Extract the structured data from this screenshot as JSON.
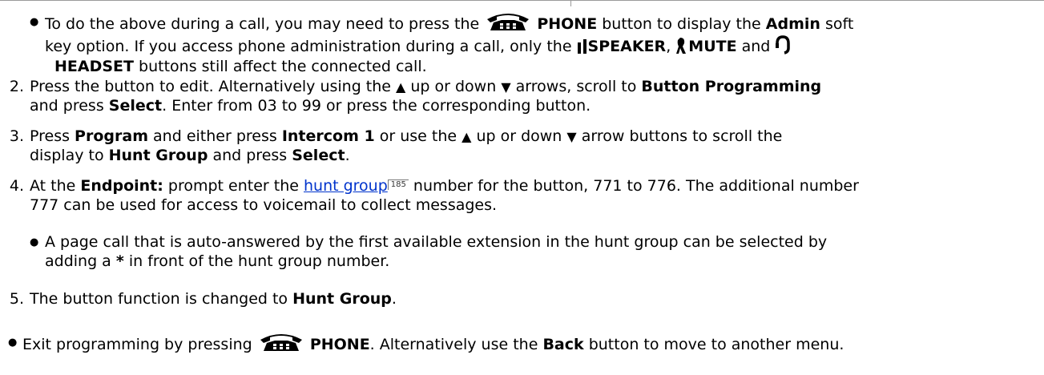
{
  "sub_bullet_1": {
    "part1": "To do the above during a call, you may need to press the ",
    "phone_label": "PHONE",
    "part2": " button to display the ",
    "admin_label": "Admin",
    "part3": " soft",
    "line2_part1": "key option. If you access phone administration during a call, only the ",
    "speaker_label": "SPEAKER",
    "comma": ",",
    "mute_label": "MUTE",
    "and": " and",
    "headset_label": "HEADSET",
    "line3_part2": " buttons still affect the connected call."
  },
  "step2": {
    "number": "2.",
    "part1": "Press the button to edit. Alternatively using the ",
    "up_arrow": "▲",
    "up_word": " up or down ",
    "down_arrow": "▼",
    "arrows_word": " arrows, scroll to ",
    "button_programming": "Button Programming",
    "line2_and": "and press ",
    "select_label": "Select",
    "line2_rest": ". Enter from 03 to 99 or press the corresponding button."
  },
  "step3": {
    "number": "3.",
    "part1": "Press ",
    "program_label": "Program",
    "part2": " and either press ",
    "intercom_label": "Intercom 1",
    "part3": " or use the ",
    "up_arrow": "▲",
    "up_word": " up or down ",
    "down_arrow": "▼",
    "part4": " arrow buttons to scroll the",
    "line2_part1": "display to ",
    "hunt_group_label": "Hunt Group",
    "line2_part2": " and press ",
    "select_label": "Select",
    "line2_end": "."
  },
  "step4": {
    "number": "4.",
    "part1": "At the ",
    "endpoint_label": "Endpoint:",
    "part2": " prompt enter the ",
    "link_text": "hunt group",
    "page_ref": "185",
    "part3": " number for the button, 771 to 776. The additional number",
    "line2": "777 can be used for access to voicemail to collect messages."
  },
  "sub_bullet_2": {
    "line1": "A page call that is auto-answered by the first available extension in the hunt group can be selected by",
    "line2_part1": "adding a ",
    "star": "*",
    "line2_part2": " in front of the hunt group number."
  },
  "step5": {
    "number": "5.",
    "part1": "The button function is changed to ",
    "hunt_group_label": "Hunt Group",
    "end": "."
  },
  "final_bullet": {
    "part1": "Exit programming by pressing ",
    "phone_label": "PHONE",
    "part2": ". Alternatively use the ",
    "back_label": "Back",
    "part3": " button to move to another menu."
  },
  "bullet_glyph": "●",
  "icon_names": [
    "phone-icon",
    "speaker-icon",
    "mute-icon",
    "headset-icon"
  ]
}
